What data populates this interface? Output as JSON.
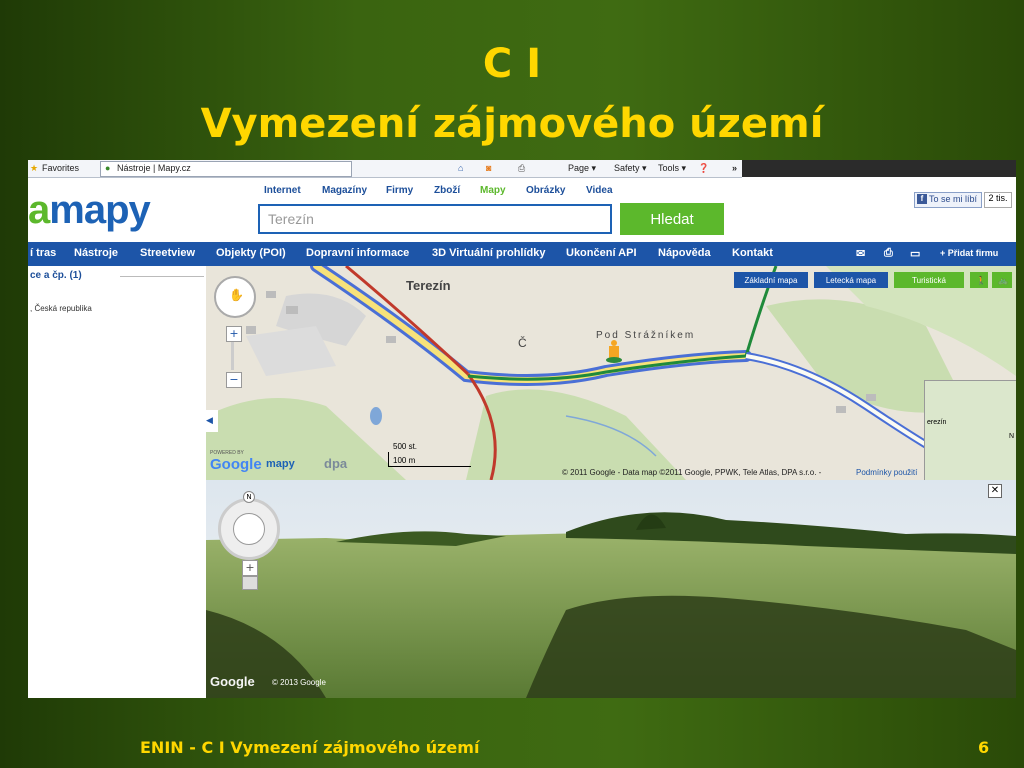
{
  "slide": {
    "title_line1": "C I",
    "title_line2": "Vymezení zájmového území",
    "footer": "ENIN - C I Vymezení zájmového území",
    "page_number": "6"
  },
  "browser": {
    "favorites": "Favorites",
    "tab_title": "Nástroje | Mapy.cz",
    "menu_page": "Page ▾",
    "menu_safety": "Safety ▾",
    "menu_tools": "Tools ▾",
    "more": "»"
  },
  "site": {
    "logo": "mapy",
    "top_nav": [
      "Internet",
      "Magazíny",
      "Firmy",
      "Zboží",
      "Mapy",
      "Obrázky",
      "Videa"
    ],
    "search_value": "Terezín",
    "search_button": "Hledat",
    "like_button": "To se mi líbí",
    "like_count": "2 tis.",
    "main_nav": [
      "í tras",
      "Nástroje",
      "Streetview",
      "Objekty (POI)",
      "Dopravní informace",
      "3D Virtuální prohlídky",
      "Ukončení API",
      "Nápověda",
      "Kontakt"
    ],
    "add_company": "+ Přidat firmu"
  },
  "sidebar": {
    "title": "ce a čp. (1)",
    "result": ", Česká republika"
  },
  "map": {
    "place_label": "Terezín",
    "place_label2": "Pod Strážníkem",
    "letter": "Č",
    "map_types": [
      "Základní mapa",
      "Letecká mapa",
      "Turistická"
    ],
    "scale_top": "500 st.",
    "scale_bottom": "100 m",
    "powered_by": "POWERED BY",
    "google": "Google",
    "partner1": "mapy",
    "partner2": "dpa",
    "copyright": "© 2011 Google - Data map ©2011 Google, PPWK, Tele Atlas, DPA s.r.o. -",
    "terms": "Podmínky použití",
    "overview_label": "erezín",
    "overview_n": "N",
    "colors": {
      "route_blue": "#4a6fd6",
      "route_yellow": "#f7e27a",
      "route_red": "#c0392b",
      "route_green": "#1f8a3a"
    }
  },
  "streetview": {
    "compass_n": "N",
    "google": "Google",
    "copyright": "© 2013 Google"
  }
}
